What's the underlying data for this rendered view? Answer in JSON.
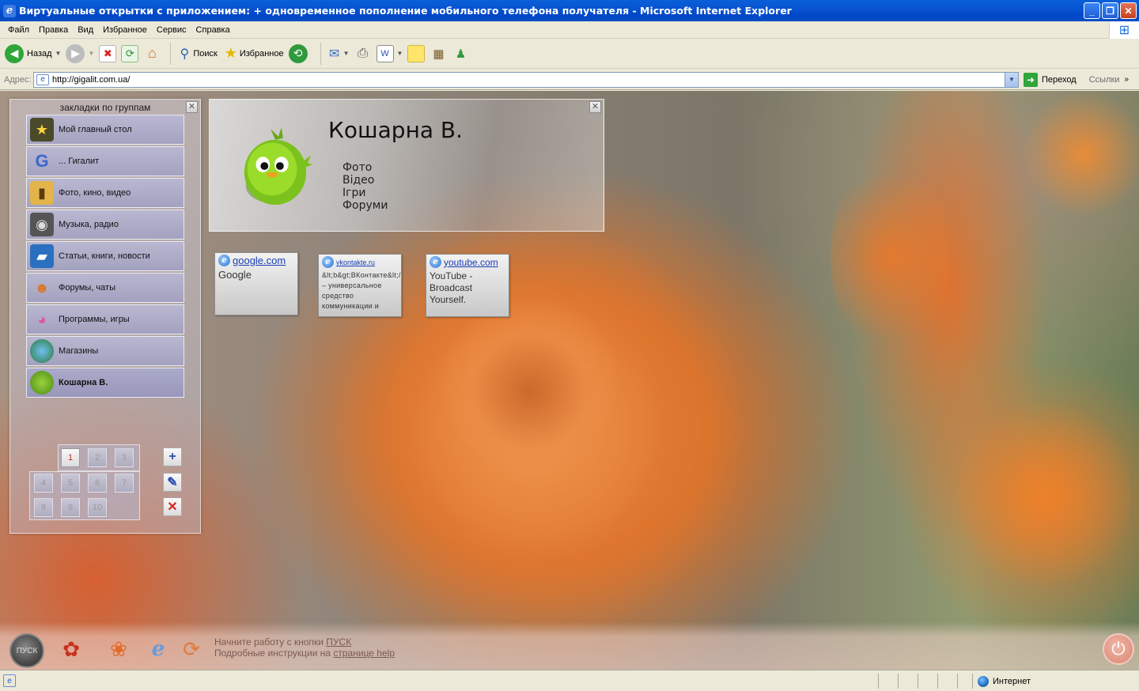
{
  "window": {
    "title": "Виртуальные открытки с приложением: + одновременное пополнение мобильного телефона получателя - Microsoft Internet Explorer",
    "buttons": {
      "minimize": "_",
      "maximize": "❐",
      "close": "✕"
    }
  },
  "menu": [
    "Файл",
    "Правка",
    "Вид",
    "Избранное",
    "Сервис",
    "Справка"
  ],
  "toolbar": {
    "back_label": "Назад",
    "search_label": "Поиск",
    "favorites_label": "Избранное"
  },
  "address": {
    "label": "Адрес:",
    "url": "http://gigalit.com.ua/",
    "go_label": "Переход",
    "links_label": "Ссылки"
  },
  "left_panel": {
    "title": "закладки по группам",
    "close": "✕",
    "groups": [
      {
        "label": "Мой главный стол",
        "icon": "star-icon"
      },
      {
        "label": "... Гигалит",
        "icon": "google-g-icon"
      },
      {
        "label": "Фото, кино, видео",
        "icon": "film-folder-icon"
      },
      {
        "label": "Музыка, радио",
        "icon": "music-cd-icon"
      },
      {
        "label": "Статьи, книги, новости",
        "icon": "book-icon"
      },
      {
        "label": "Форумы, чаты",
        "icon": "people-icon"
      },
      {
        "label": "Программы, игры",
        "icon": "pacman-icon"
      },
      {
        "label": "Магазины",
        "icon": "globe-icon"
      },
      {
        "label": "Кошарна В.",
        "icon": "green-bird-icon"
      }
    ],
    "active_group": 8,
    "pages": [
      "1",
      "2",
      "3",
      "4",
      "5",
      "6",
      "7",
      "8",
      "9",
      "10"
    ],
    "current_page": "1",
    "actions": {
      "add": "+",
      "edit": "✎",
      "delete": "✕"
    }
  },
  "profile": {
    "name": "Кошарна В.",
    "links": [
      "Фото",
      "Відео",
      "Ігри",
      "Форуми"
    ],
    "close": "✕"
  },
  "tiles": [
    {
      "link": "google.com",
      "desc": "Google"
    },
    {
      "link": "vkontakte.ru",
      "desc": "&lt;b&gt;ВКонтакте&lt;/b&gt; – универсальное средство коммуникации и"
    },
    {
      "link": "youtube.com",
      "desc": "YouTube - Broadcast Yourself."
    }
  ],
  "bottom": {
    "pusk_label": "ПУСК",
    "hint_line1_prefix": "Начните работу с кнопки ",
    "hint_line1_link": "ПУСК",
    "hint_line2_prefix": "Подробные инструкции на ",
    "hint_line2_link": "странице help"
  },
  "status": {
    "zone": "Интернет"
  },
  "colors": {
    "title_bar": "#0054e3",
    "chrome": "#ece9d8",
    "link": "#1a3fb5",
    "active_page": "#cc2222"
  }
}
